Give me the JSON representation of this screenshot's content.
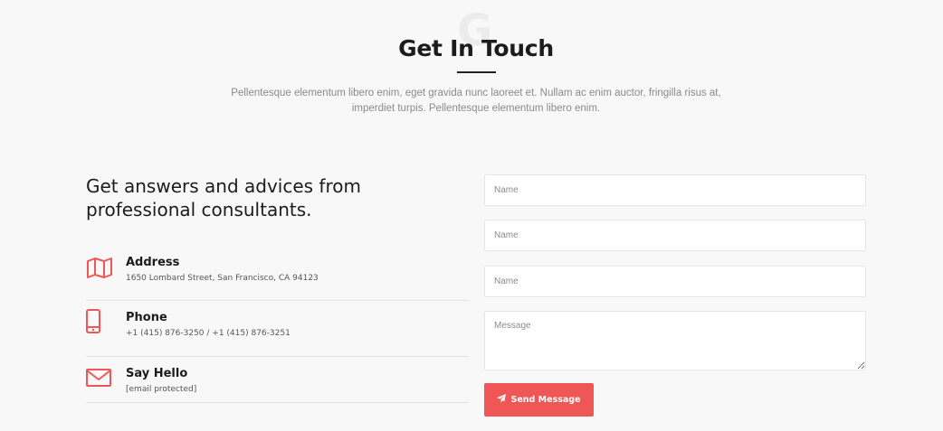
{
  "section": {
    "watermark": "G",
    "title": "Get In Touch",
    "intro": "Pellentesque elementum libero enim, eget gravida nunc laoreet et. Nullam ac enim auctor, fringilla risus at, imperdiet turpis. Pellentesque elementum libero enim."
  },
  "contact": {
    "heading": "Get answers and advices from professional consultants.",
    "items": [
      {
        "icon": "map-icon",
        "label": "Address",
        "value": "1650 Lombard Street, San Francisco, CA 94123"
      },
      {
        "icon": "phone-icon",
        "label": "Phone",
        "value": "+1 (415) 876-3250 / +1 (415) 876-3251"
      },
      {
        "icon": "envelope-icon",
        "label": "Say Hello",
        "value": "[email protected]"
      }
    ]
  },
  "form": {
    "fields": [
      {
        "placeholder": "Name",
        "value": ""
      },
      {
        "placeholder": "Name",
        "value": ""
      },
      {
        "placeholder": "Name",
        "value": ""
      }
    ],
    "message_placeholder": "Message",
    "submit_label": "Send Message",
    "submit_icon": "paper-plane-icon"
  },
  "colors": {
    "accent": "#ef5656",
    "background": "#f8f8f8",
    "heading": "#1c1c1c",
    "muted": "#8a8a8a"
  }
}
